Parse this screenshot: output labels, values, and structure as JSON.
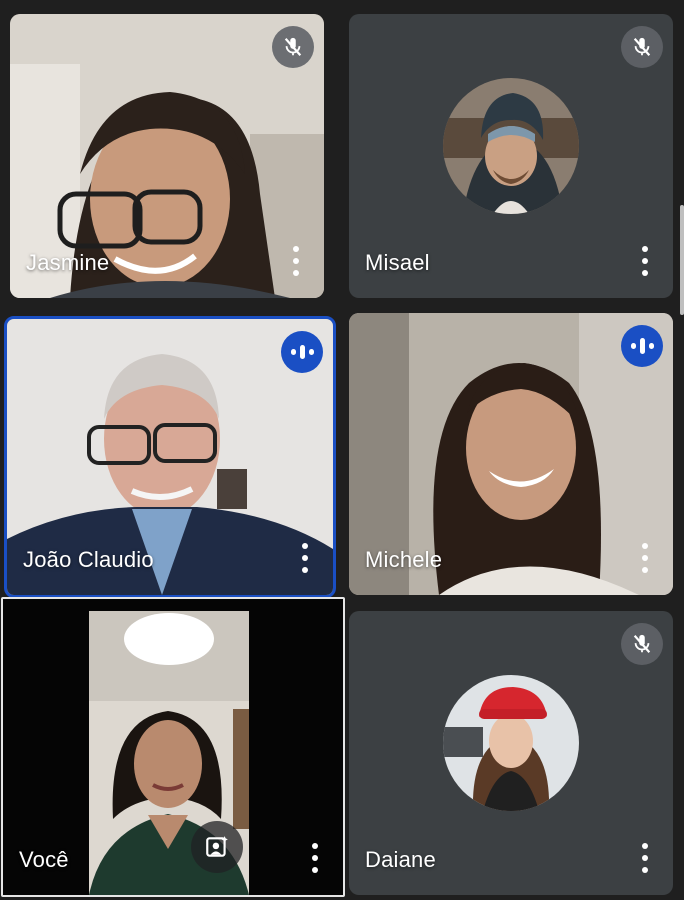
{
  "participants": [
    {
      "name": "Jasmine",
      "mic": "muted"
    },
    {
      "name": "Misael",
      "mic": "muted"
    },
    {
      "name": "João Claudio",
      "mic": "speaking"
    },
    {
      "name": "Michele",
      "mic": "speaking"
    },
    {
      "name": "Você",
      "mic": "on"
    },
    {
      "name": "Daiane",
      "mic": "muted"
    }
  ],
  "icons": {
    "mic_off": "mic-off-icon",
    "speaking": "audio-level-icon",
    "more": "more-vert-icon",
    "effects": "visual-effects-icon"
  },
  "colors": {
    "background": "#1f1f1f",
    "tile": "#3c4043",
    "active_speaker_border": "#1a4fc4",
    "mic_off_badge": "#5f6368"
  }
}
